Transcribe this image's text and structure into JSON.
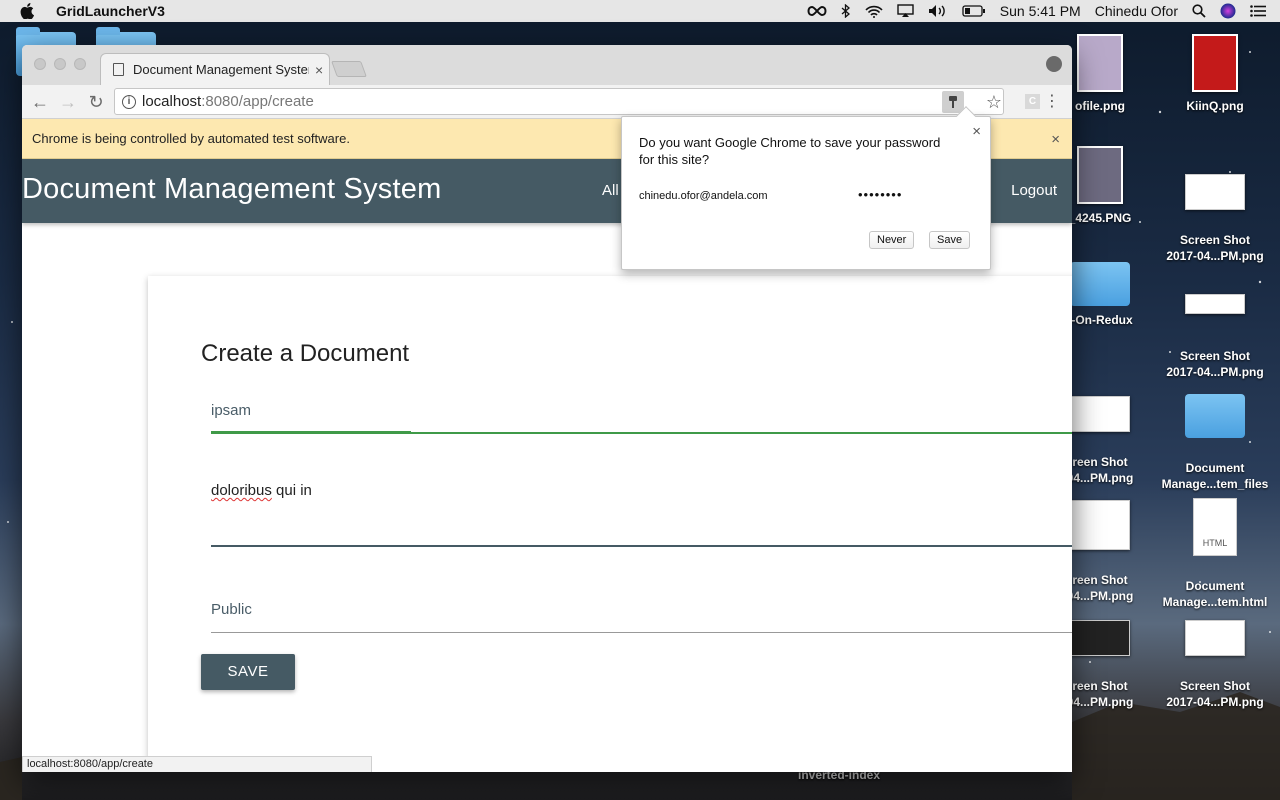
{
  "menubar": {
    "app_name": "GridLauncherV3",
    "clock": "Sun 5:41 PM",
    "user": "Chinedu Ofor"
  },
  "desktop": {
    "items_col1": [
      {
        "label": "ofile.png",
        "kind": "image"
      },
      {
        "label": "_4245.PNG",
        "kind": "image"
      },
      {
        "label": "t-On-Redux",
        "kind": "folder"
      },
      {
        "label": "reen Shot\n04...PM.png",
        "kind": "shot"
      },
      {
        "label": "reen Shot\n04...PM.png",
        "kind": "shot"
      },
      {
        "label": "reen Shot\n04...PM.png",
        "kind": "shot"
      }
    ],
    "items_col2": [
      {
        "label": "KiinQ.png",
        "kind": "image"
      },
      {
        "label": "Screen Shot\n2017-04...PM.png",
        "kind": "shot"
      },
      {
        "label": "Screen Shot\n2017-04...PM.png",
        "kind": "shot"
      },
      {
        "label": "Document\nManage...tem_files",
        "kind": "folder"
      },
      {
        "label": "Document\nManage...tem.html",
        "kind": "html"
      },
      {
        "label": "Screen Shot\n2017-04...PM.png",
        "kind": "shot"
      }
    ],
    "html_badge": "HTML",
    "bottom_label": "inverted-index"
  },
  "browser": {
    "tab_title": "Document Management System",
    "url_host": "localhost",
    "url_path": ":8080/app/create",
    "ext_letter": "C",
    "infobar_text": "Chrome is being controlled by automated test software.",
    "status_url": "localhost:8080/app/create"
  },
  "app": {
    "brand": "Document Management System",
    "nav_all": "All",
    "nav_logout": "Logout",
    "form": {
      "heading": "Create a Document",
      "title_value": "ipsam",
      "body_word1": "doloribus",
      "body_rest": " qui in",
      "access_value": "Public",
      "save_label": "SAVE"
    }
  },
  "password_bubble": {
    "question": "Do you want Google Chrome to save your password for this site?",
    "username": "chinedu.ofor@andela.com",
    "password_mask": "••••••••",
    "never_label": "Never",
    "save_label": "Save"
  }
}
